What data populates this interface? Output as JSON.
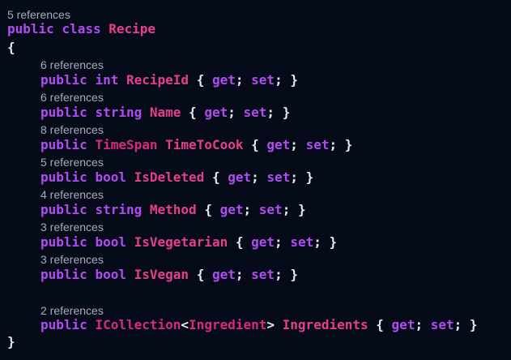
{
  "colors": {
    "background": "#050b19",
    "keyword": "#b14cf0",
    "type": "#d92a7d",
    "identifier": "#e63f8a",
    "punctuation": "#e8eaf2",
    "codelens": "#a5acba"
  },
  "class_decl": {
    "refs": "5 references",
    "kw_public": "public",
    "kw_class": "class",
    "name": "Recipe",
    "open_brace": "{",
    "close_brace": "}"
  },
  "properties": [
    {
      "refs": "6 references",
      "modifier": "public",
      "type": "int",
      "name": "RecipeId"
    },
    {
      "refs": "6 references",
      "modifier": "public",
      "type": "string",
      "name": "Name"
    },
    {
      "refs": "8 references",
      "modifier": "public",
      "type": "TimeSpan",
      "name": "TimeToCook"
    },
    {
      "refs": "5 references",
      "modifier": "public",
      "type": "bool",
      "name": "IsDeleted"
    },
    {
      "refs": "4 references",
      "modifier": "public",
      "type": "string",
      "name": "Method"
    },
    {
      "refs": "3 references",
      "modifier": "public",
      "type": "bool",
      "name": "IsVegetarian"
    },
    {
      "refs": "3 references",
      "modifier": "public",
      "type": "bool",
      "name": "IsVegan"
    }
  ],
  "collection_property": {
    "refs": "2 references",
    "modifier": "public",
    "generic_type": "ICollection",
    "lt": "<",
    "type_arg": "Ingredient",
    "gt": ">",
    "name": "Ingredients"
  },
  "accessor": {
    "open": "{",
    "get": "get",
    "semi": ";",
    "set": "set",
    "close": "}"
  }
}
